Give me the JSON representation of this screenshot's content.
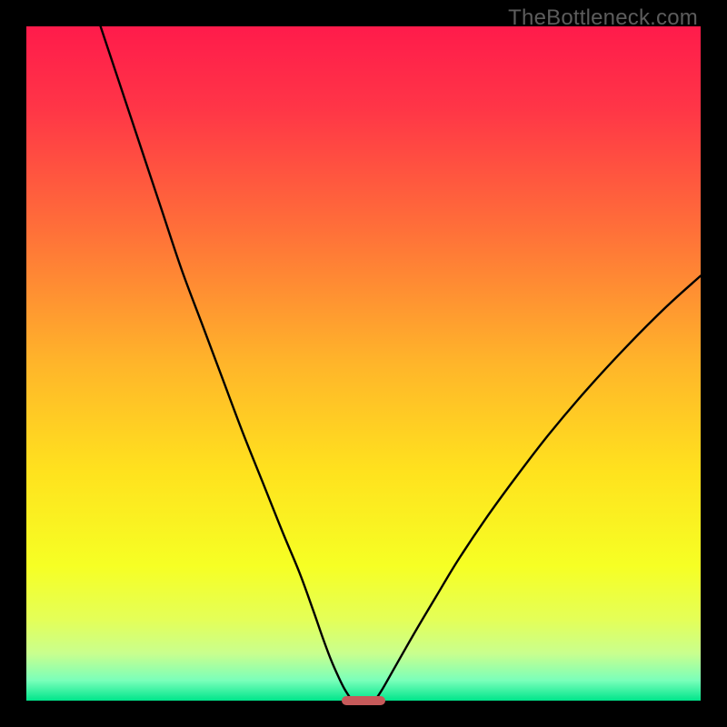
{
  "watermark": {
    "text": "TheBottleneck.com"
  },
  "chart_data": {
    "type": "line",
    "title": "",
    "xlabel": "",
    "ylabel": "",
    "xlim": [
      0,
      100
    ],
    "ylim": [
      0,
      100
    ],
    "background_gradient": {
      "direction": "vertical-top-to-bottom",
      "stops": [
        {
          "pct": 0,
          "color": "#ff1b4b"
        },
        {
          "pct": 12,
          "color": "#ff3547"
        },
        {
          "pct": 30,
          "color": "#ff6f39"
        },
        {
          "pct": 50,
          "color": "#ffb52a"
        },
        {
          "pct": 66,
          "color": "#ffe21e"
        },
        {
          "pct": 80,
          "color": "#f6ff24"
        },
        {
          "pct": 88,
          "color": "#e4ff58"
        },
        {
          "pct": 93,
          "color": "#c9ff8e"
        },
        {
          "pct": 97,
          "color": "#7affba"
        },
        {
          "pct": 100,
          "color": "#00e58b"
        }
      ]
    },
    "series": [
      {
        "name": "left-curve",
        "stroke": "#000000",
        "stroke_width": 2.4,
        "x": [
          11,
          14,
          17,
          20,
          23,
          26,
          29,
          32,
          35,
          38,
          40.5,
          42.5,
          44,
          45.2,
          46.3,
          47.2,
          48.3
        ],
        "y": [
          100,
          91,
          82,
          73,
          64,
          56,
          48,
          40,
          32.5,
          25,
          19,
          13.5,
          9.2,
          6,
          3.5,
          1.7,
          0
        ]
      },
      {
        "name": "right-curve",
        "stroke": "#000000",
        "stroke_width": 2.4,
        "x": [
          51.7,
          52.8,
          54,
          55.7,
          58,
          60.8,
          64,
          68,
          72.5,
          77.5,
          83,
          89,
          95,
          100
        ],
        "y": [
          0,
          1.7,
          3.8,
          6.8,
          10.8,
          15.5,
          20.8,
          26.8,
          33,
          39.5,
          46,
          52.5,
          58.5,
          63
        ]
      }
    ],
    "baseline_marker": {
      "x_start": 46.7,
      "x_end": 53.3,
      "y": 0,
      "color": "#c65a5a"
    },
    "curve_color": "#000000"
  }
}
